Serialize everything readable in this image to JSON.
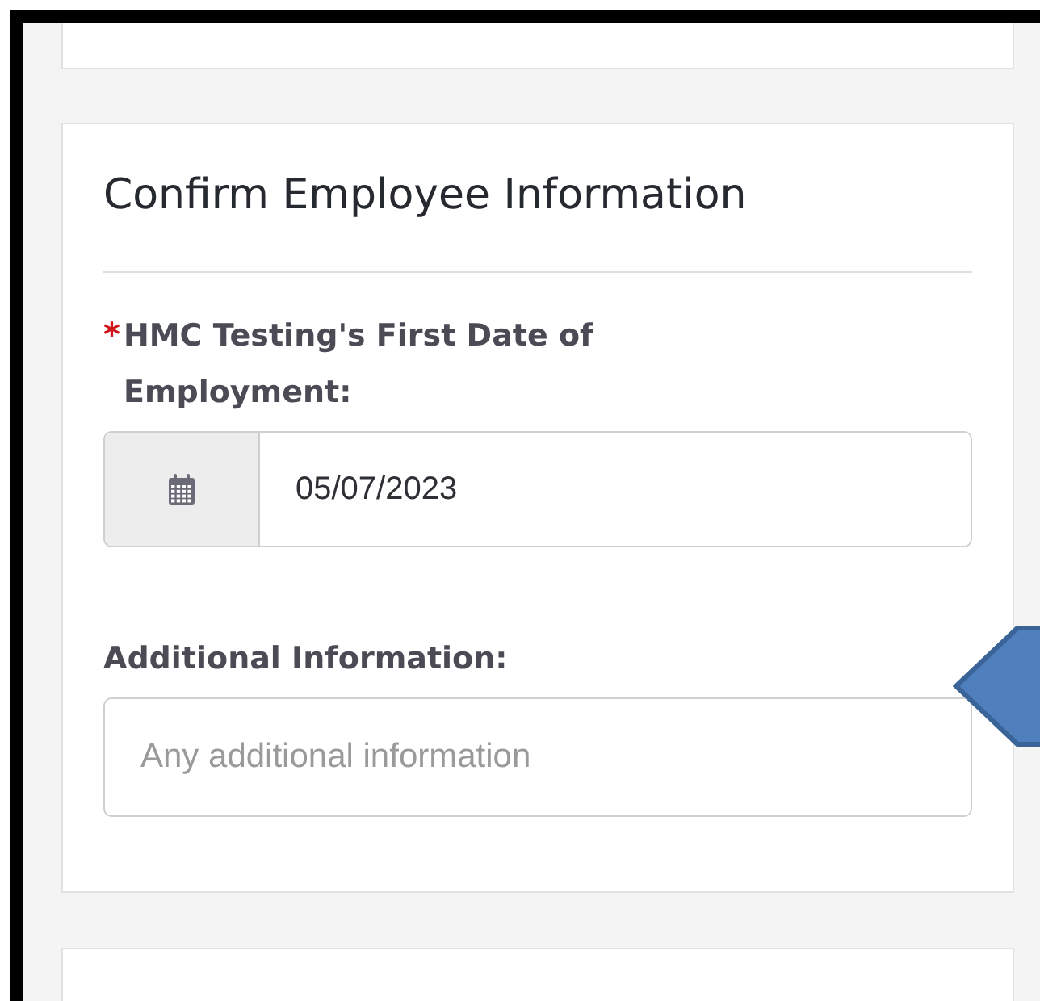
{
  "section": {
    "title": "Confirm Employee Information",
    "fields": [
      {
        "kind": "date",
        "required_mark": "*",
        "label": "HMC Testing's First Date of Employment:",
        "value": "05/07/2023"
      },
      {
        "kind": "text",
        "label": "Additional Information:",
        "placeholder": "Any additional information"
      }
    ]
  }
}
